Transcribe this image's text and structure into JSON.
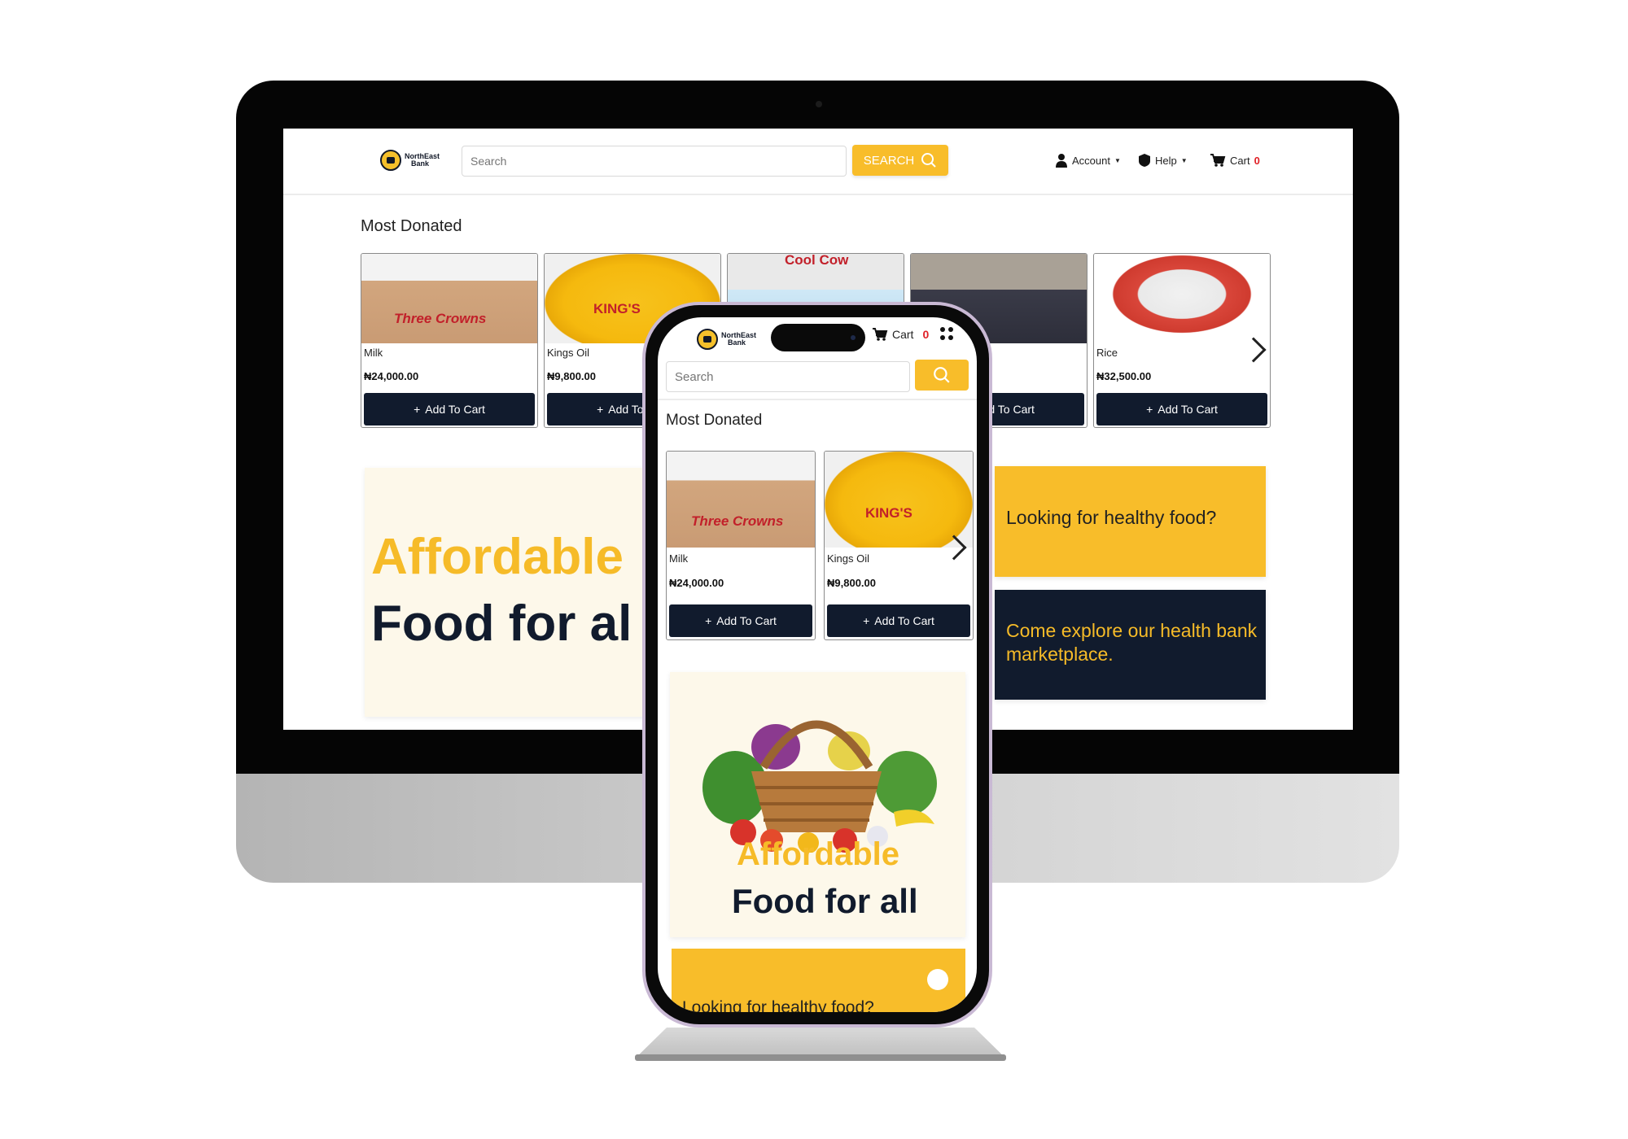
{
  "brand": {
    "name_line1": "NorthEast",
    "name_line2": "Bank"
  },
  "desktop": {
    "search_placeholder": "Search",
    "search_button": "SEARCH",
    "nav": {
      "account": "Account",
      "help": "Help",
      "cart": "Cart",
      "cart_count": "0"
    },
    "section_title": "Most Donated",
    "add_to_cart": "Add To Cart",
    "products": [
      {
        "name": "Milk",
        "price": "₦24,000.00"
      },
      {
        "name": "Kings Oil",
        "price": "₦9,800.00"
      },
      {
        "name": "",
        "price": ""
      },
      {
        "name": "",
        "price": ""
      },
      {
        "name": "Rice",
        "price": "₦32,500.00"
      }
    ],
    "hero": {
      "line1": "Affordable",
      "line2": "Food for al"
    },
    "promo_yellow": "Looking for healthy food?",
    "promo_dark": "Come explore our health bank marketplace."
  },
  "mobile": {
    "cart_label": "Cart",
    "cart_count": "0",
    "search_placeholder": "Search",
    "section_title": "Most Donated",
    "add_to_cart": "Add To Cart",
    "products": [
      {
        "name": "Milk",
        "price": "₦24,000.00"
      },
      {
        "name": "Kings Oil",
        "price": "₦9,800.00"
      }
    ],
    "hero": {
      "line1": "Affordable",
      "line2": "Food for all"
    },
    "promo_yellow": "Looking for healthy food?"
  },
  "product_labels": {
    "milk_brand": "Three Crowns",
    "oil_brand": "KING'S",
    "cow_brand": "Cool Cow"
  },
  "colors": {
    "accent": "#f8bd2a",
    "navy": "#111b2d",
    "cream": "#fdf8ea",
    "cart_badge": "#e01f26"
  },
  "icons": [
    "user-icon",
    "help-shield-icon",
    "cart-icon",
    "search-icon",
    "plus-icon",
    "chevron-right-icon",
    "grid-menu-icon",
    "chat-bubble-icon"
  ]
}
